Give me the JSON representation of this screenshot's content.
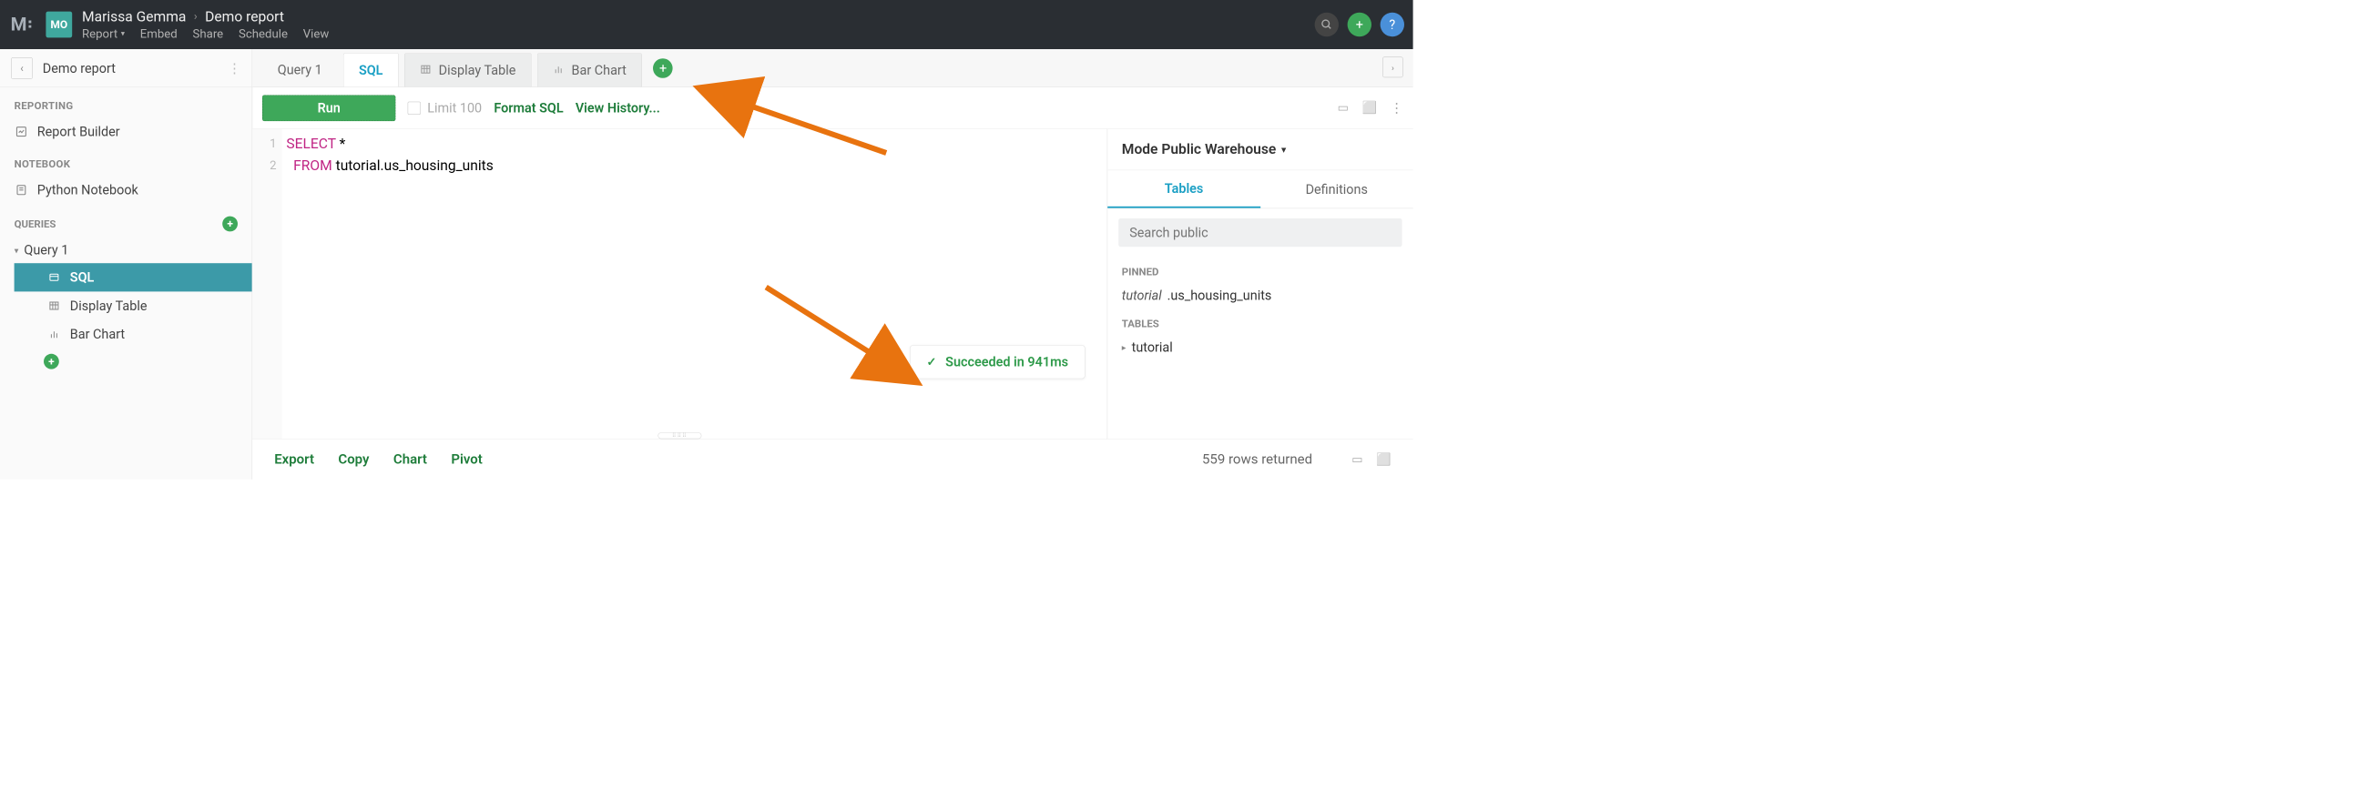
{
  "header": {
    "user_initials": "MO",
    "breadcrumb_user": "Marissa Gemma",
    "breadcrumb_report": "Demo report",
    "nav": {
      "report": "Report",
      "embed": "Embed",
      "share": "Share",
      "schedule": "Schedule",
      "view": "View"
    }
  },
  "sidebar": {
    "title": "Demo report",
    "sections": {
      "reporting": "REPORTING",
      "notebook": "NOTEBOOK",
      "queries": "QUERIES"
    },
    "report_builder": "Report Builder",
    "python_notebook": "Python Notebook",
    "query1": "Query 1",
    "sql": "SQL",
    "display_table": "Display Table",
    "bar_chart": "Bar Chart"
  },
  "tabs": {
    "query1": "Query 1",
    "sql": "SQL",
    "display_table": "Display Table",
    "bar_chart": "Bar Chart"
  },
  "toolbar": {
    "run": "Run",
    "limit": "Limit 100",
    "format_sql": "Format SQL",
    "view_history": "View History..."
  },
  "editor": {
    "line1_kw": "SELECT",
    "line1_rest": " *",
    "line2_kw": "FROM",
    "line2_rest": " tutorial.us_housing_units"
  },
  "status": {
    "text": "Succeeded in 941ms"
  },
  "schema": {
    "source_label": "Mode Public Warehouse",
    "tab_tables": "Tables",
    "tab_definitions": "Definitions",
    "search_placeholder": "Search public",
    "pinned_label": "PINNED",
    "pinned_item_schema": "tutorial",
    "pinned_item_rest": ".us_housing_units",
    "tables_label": "TABLES",
    "tables_item": "tutorial"
  },
  "footer": {
    "export": "Export",
    "copy": "Copy",
    "chart": "Chart",
    "pivot": "Pivot",
    "rows": "559 rows returned"
  }
}
